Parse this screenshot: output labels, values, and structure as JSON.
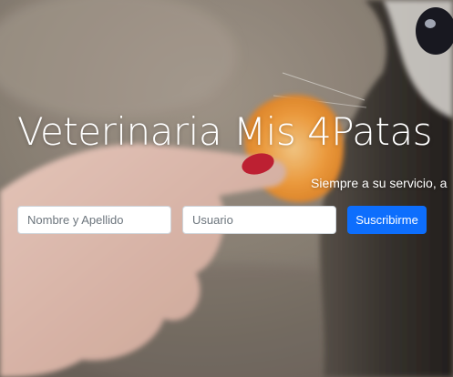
{
  "hero": {
    "title": "Veterinaria Mis 4Patas",
    "tagline": "Siempre a su servicio, a",
    "background_image": "hand-feeding-orange-slice-to-cat-photo"
  },
  "subscribe_form": {
    "name_placeholder": "Nombre y Apellido",
    "name_value": "",
    "user_placeholder": "Usuario",
    "user_value": "",
    "submit_label": "Suscribirme"
  },
  "colors": {
    "button_primary": "#0d6efd",
    "text_light": "#ffffff",
    "input_border": "#ced4da"
  }
}
